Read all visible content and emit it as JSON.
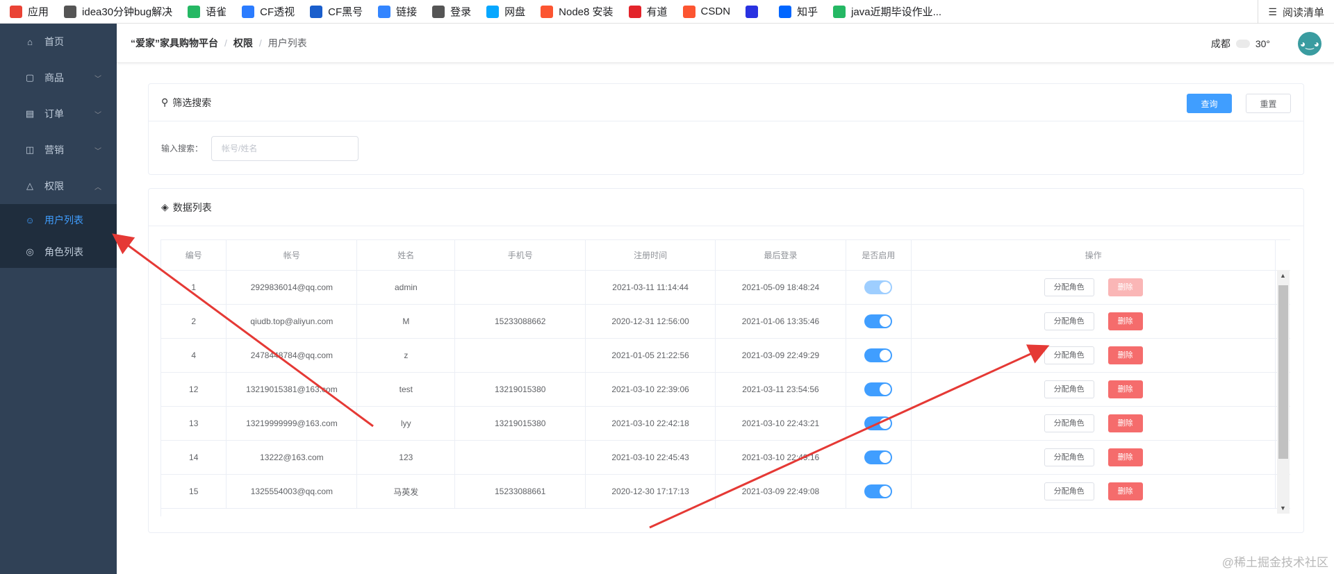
{
  "bookmarks": [
    {
      "label": "应用",
      "icon": "apps-grid-icon",
      "color": "#ea4335"
    },
    {
      "label": "idea30分钟bug解决",
      "icon": "link-icon",
      "color": "#555555"
    },
    {
      "label": "语雀",
      "icon": "yuque-icon",
      "color": "#25b864"
    },
    {
      "label": "CF透视",
      "icon": "cf-icon",
      "color": "#2b7cff"
    },
    {
      "label": "CF黑号",
      "icon": "cf-bird-icon",
      "color": "#1a5ecc"
    },
    {
      "label": "链接",
      "icon": "paw-icon",
      "color": "#3385ff"
    },
    {
      "label": "登录",
      "icon": "globe-icon",
      "color": "#555555"
    },
    {
      "label": "网盘",
      "icon": "cloud-drive-icon",
      "color": "#06a7ff"
    },
    {
      "label": "Node8 安装",
      "icon": "csdn-c-icon",
      "color": "#fc5531"
    },
    {
      "label": "有道",
      "icon": "youdao-icon",
      "color": "#e3242b"
    },
    {
      "label": "CSDN",
      "icon": "csdn-c-icon",
      "color": "#fc5531"
    },
    {
      "label": "",
      "icon": "baidu-paw-icon",
      "color": "#2932e1"
    },
    {
      "label": "知乎",
      "icon": "zhihu-icon",
      "color": "#0066ff"
    },
    {
      "label": "java近期毕设作业...",
      "icon": "feather-icon",
      "color": "#25b864"
    }
  ],
  "reading_list": "阅读清单",
  "sidebar": {
    "items": [
      {
        "label": "首页",
        "icon": "home-icon",
        "chevron": ""
      },
      {
        "label": "商品",
        "icon": "bag-icon",
        "chevron": "﹀"
      },
      {
        "label": "订单",
        "icon": "document-icon",
        "chevron": "﹀"
      },
      {
        "label": "营销",
        "icon": "gift-icon",
        "chevron": "﹀"
      },
      {
        "label": "权限",
        "icon": "bell-icon",
        "chevron": "︿"
      }
    ],
    "submenu": [
      {
        "label": "用户列表",
        "icon": "user-icon",
        "active": true
      },
      {
        "label": "角色列表",
        "icon": "role-icon",
        "active": false
      }
    ]
  },
  "header": {
    "crumb1": "“爱家”家具购物平台",
    "crumb2": "权限",
    "crumb3": "用户列表",
    "sep": "/",
    "city": "成都",
    "temp": "30°"
  },
  "filter": {
    "title": "筛选搜索",
    "query_btn": "查询",
    "reset_btn": "重置",
    "input_label": "输入搜索：",
    "input_placeholder": "帐号/姓名"
  },
  "list": {
    "title": "数据列表",
    "columns": [
      "编号",
      "帐号",
      "姓名",
      "手机号",
      "注册时间",
      "最后登录",
      "是否启用",
      "操作"
    ],
    "assign_label": "分配角色",
    "delete_label": "删除",
    "rows": [
      {
        "id": "1",
        "account": "2929836014@qq.com",
        "name": "admin",
        "phone": "",
        "reg": "2021-03-11 11:14:44",
        "last": "2021-05-09 18:48:24",
        "enabled": true,
        "disabled": true
      },
      {
        "id": "2",
        "account": "qiudb.top@aliyun.com",
        "name": "M",
        "phone": "15233088662",
        "reg": "2020-12-31 12:56:00",
        "last": "2021-01-06 13:35:46",
        "enabled": true,
        "disabled": false
      },
      {
        "id": "4",
        "account": "2478448784@qq.com",
        "name": "z",
        "phone": "",
        "reg": "2021-01-05 21:22:56",
        "last": "2021-03-09 22:49:29",
        "enabled": true,
        "disabled": false
      },
      {
        "id": "12",
        "account": "13219015381@163.com",
        "name": "test",
        "phone": "13219015380",
        "reg": "2021-03-10 22:39:06",
        "last": "2021-03-11 23:54:56",
        "enabled": true,
        "disabled": false
      },
      {
        "id": "13",
        "account": "13219999999@163.com",
        "name": "lyy",
        "phone": "13219015380",
        "reg": "2021-03-10 22:42:18",
        "last": "2021-03-10 22:43:21",
        "enabled": true,
        "disabled": false
      },
      {
        "id": "14",
        "account": "13222@163.com",
        "name": "123",
        "phone": "",
        "reg": "2021-03-10 22:45:43",
        "last": "2021-03-10 22:49:16",
        "enabled": true,
        "disabled": false
      },
      {
        "id": "15",
        "account": "1325554003@qq.com",
        "name": "马英发",
        "phone": "15233088661",
        "reg": "2020-12-30 17:17:13",
        "last": "2021-03-09 22:49:08",
        "enabled": true,
        "disabled": false
      }
    ]
  },
  "watermark": "@稀土掘金技术社区",
  "colors": {
    "sidebar_bg": "#304156",
    "accent": "#409eff",
    "danger": "#f56c6c",
    "arrow": "#e53935"
  }
}
